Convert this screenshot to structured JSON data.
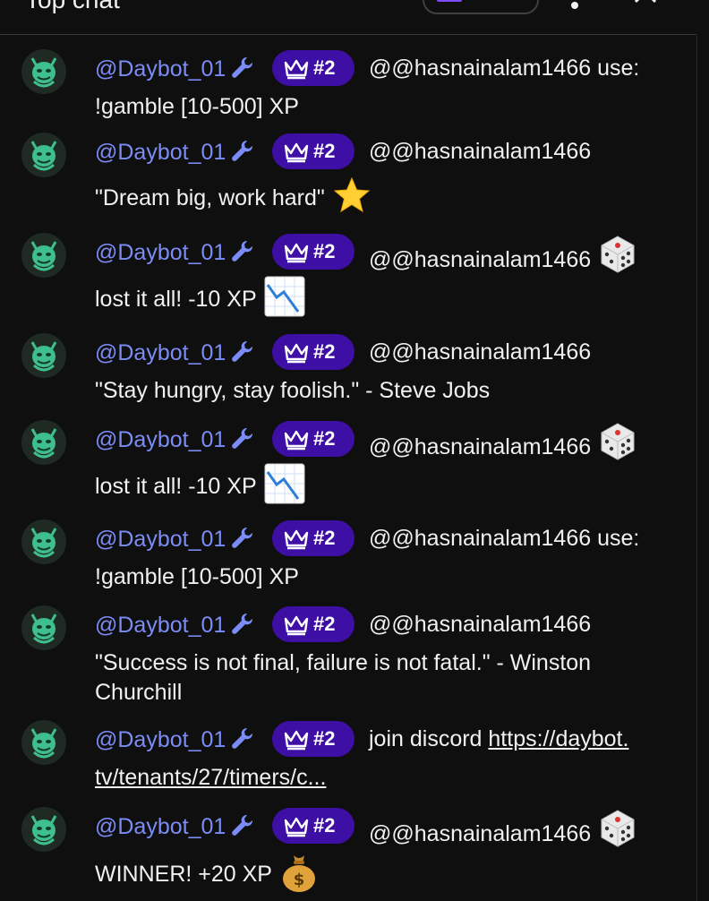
{
  "header": {
    "title": "Top chat"
  },
  "messages": [
    {
      "author": "@Daybot_01",
      "rank": "#2",
      "text": "@@hasnainalam1466 use:",
      "cont": "!gamble [10-500] XP",
      "emoji": ""
    },
    {
      "author": "@Daybot_01",
      "rank": "#2",
      "text": "@@hasnainalam1466",
      "cont": "\"Dream big, work hard\"",
      "emoji": "star"
    },
    {
      "author": "@Daybot_01",
      "rank": "#2",
      "text": "@@hasnainalam1466",
      "cont": "lost it all! -10 XP",
      "emoji": "dice+chart"
    },
    {
      "author": "@Daybot_01",
      "rank": "#2",
      "text": "@@hasnainalam1466",
      "cont": "\"Stay hungry, stay foolish.\" - Steve Jobs",
      "emoji": ""
    },
    {
      "author": "@Daybot_01",
      "rank": "#2",
      "text": "@@hasnainalam1466",
      "cont": "lost it all! -10 XP",
      "emoji": "dice+chart"
    },
    {
      "author": "@Daybot_01",
      "rank": "#2",
      "text": "@@hasnainalam1466 use:",
      "cont": "!gamble [10-500] XP",
      "emoji": ""
    },
    {
      "author": "@Daybot_01",
      "rank": "#2",
      "text": "@@hasnainalam1466",
      "cont": "\"Success is not final, failure is not fatal.\" - Winston",
      "cont2": "Churchill",
      "emoji": ""
    },
    {
      "author": "@Daybot_01",
      "rank": "#2",
      "text": "join discord",
      "link1": "https://daybot.",
      "link2": "tv/tenants/27/timers/c...",
      "emoji": ""
    },
    {
      "author": "@Daybot_01",
      "rank": "#2",
      "text": "@@hasnainalam1466",
      "cont": "WINNER! +20 XP",
      "emoji": "dice+money"
    }
  ]
}
